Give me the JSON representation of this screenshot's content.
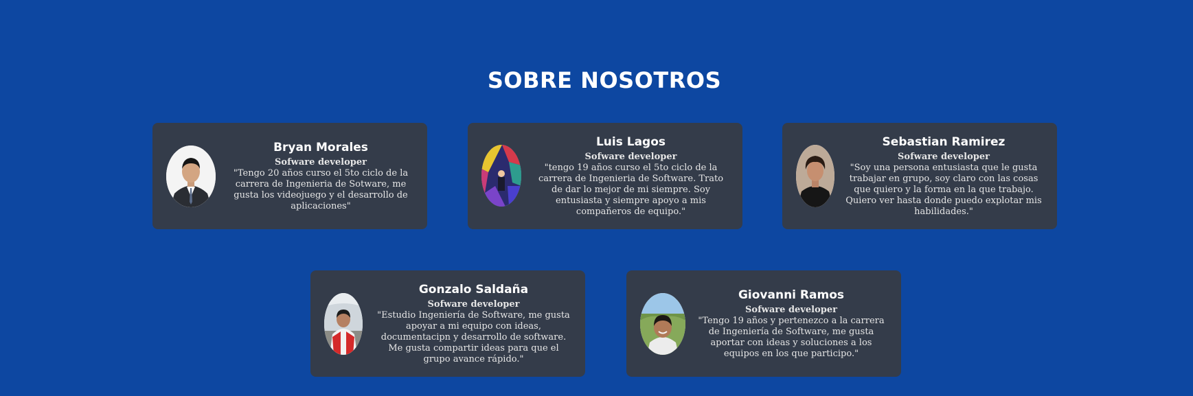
{
  "section": {
    "title": "SOBRE NOSOTROS"
  },
  "members": [
    {
      "name": "Bryan Morales",
      "role": "Sofware developer",
      "description": "\"Tengo 20 años curso el 5to ciclo de la carrera de Ingenieria de Sotware, me gusta los videojuego y el desarrollo de aplicaciones\""
    },
    {
      "name": "Luis Lagos",
      "role": "Sofware developer",
      "description": "\"tengo 19 años curso el 5to ciclo de la carrera de Ingenieria de Software. Trato de dar lo mejor de mi siempre. Soy entusiasta y siempre apoyo a mis compañeros de equipo.\""
    },
    {
      "name": "Sebastian Ramirez",
      "role": "Sofware developer",
      "description": "\"Soy una persona entusiasta que le gusta trabajar en grupo, soy claro con las cosas que quiero y la forma en la que trabajo. Quiero ver hasta donde puedo explotar mis habilidades.\""
    },
    {
      "name": "Gonzalo Saldaña",
      "role": "Sofware developer",
      "description": "\"Estudio Ingeniería de Software, me gusta apoyar a mi equipo con ideas, documentacipn y desarrollo de software. Me gusta compartir ideas para que el grupo avance rápido.\""
    },
    {
      "name": "Giovanni Ramos",
      "role": "Sofware developer",
      "description": "\"Tengo 19 años y pertenezco a la carrera de Ingeniería de Software, me gusta aportar con ideas y soluciones a los equipos en los que participo.\""
    }
  ]
}
